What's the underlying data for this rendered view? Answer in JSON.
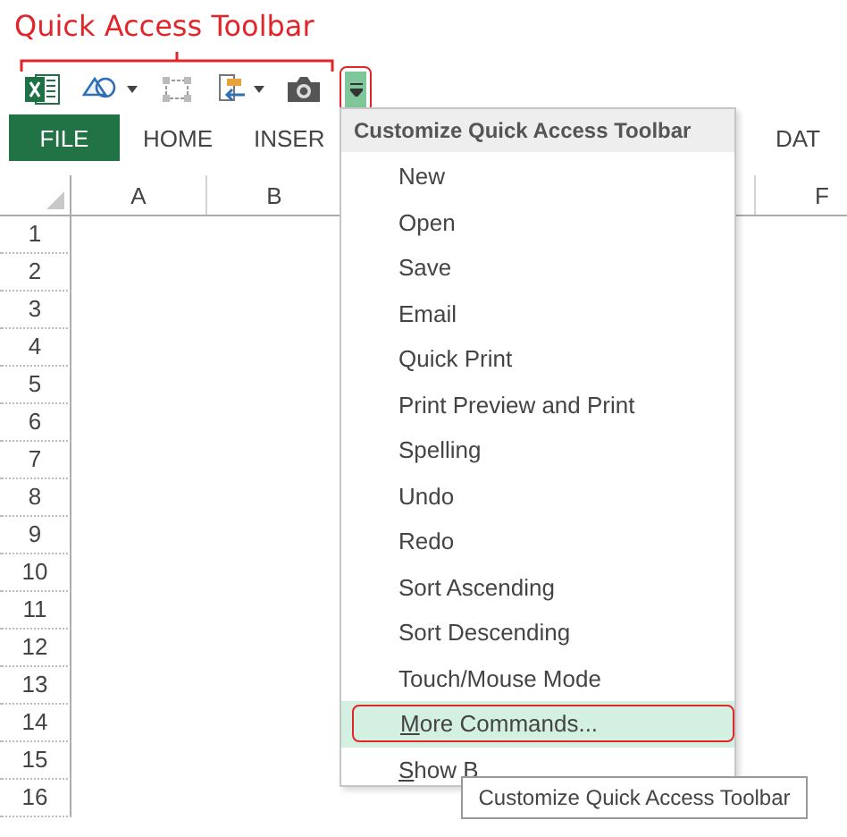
{
  "annotation": {
    "label": "Quick Access Toolbar"
  },
  "toolbar": {
    "buttons": [
      {
        "kind": "excel"
      },
      {
        "kind": "shapes",
        "dropdown": true
      },
      {
        "kind": "select"
      },
      {
        "kind": "form",
        "dropdown": true
      },
      {
        "kind": "camera"
      }
    ],
    "customize_button": {
      "highlighted": true
    }
  },
  "ribbon_tabs": [
    {
      "label": "FILE",
      "selected": true
    },
    {
      "label": "HOME",
      "selected": false
    },
    {
      "label": "INSER",
      "selected": false
    }
  ],
  "ribbon_tabs_right": [
    {
      "label": "DAT",
      "selected": false
    }
  ],
  "sheet": {
    "columns": [
      "A",
      "B",
      "F"
    ],
    "rows": [
      "1",
      "2",
      "3",
      "4",
      "5",
      "6",
      "7",
      "8",
      "9",
      "10",
      "11",
      "12",
      "13",
      "14",
      "15",
      "16"
    ]
  },
  "menu": {
    "title": "Customize Quick Access Toolbar",
    "items": [
      {
        "label": "New",
        "highlighted": false,
        "mnemonic": false
      },
      {
        "label": "Open",
        "highlighted": false,
        "mnemonic": false
      },
      {
        "label": "Save",
        "highlighted": false,
        "mnemonic": false
      },
      {
        "label": "Email",
        "highlighted": false,
        "mnemonic": false
      },
      {
        "label": "Quick Print",
        "highlighted": false,
        "mnemonic": false
      },
      {
        "label": "Print Preview and Print",
        "highlighted": false,
        "mnemonic": false
      },
      {
        "label": "Spelling",
        "highlighted": false,
        "mnemonic": false
      },
      {
        "label": "Undo",
        "highlighted": false,
        "mnemonic": false
      },
      {
        "label": "Redo",
        "highlighted": false,
        "mnemonic": false
      },
      {
        "label": "Sort Ascending",
        "highlighted": false,
        "mnemonic": false
      },
      {
        "label": "Sort Descending",
        "highlighted": false,
        "mnemonic": false
      },
      {
        "label": "Touch/Mouse Mode",
        "highlighted": false,
        "mnemonic": false
      },
      {
        "label": "More Commands...",
        "highlighted": true,
        "mnemonic": true
      },
      {
        "label": "Show B",
        "highlighted": false,
        "mnemonic": true
      }
    ]
  },
  "tooltip": {
    "text": "Customize Quick Access Toolbar"
  }
}
